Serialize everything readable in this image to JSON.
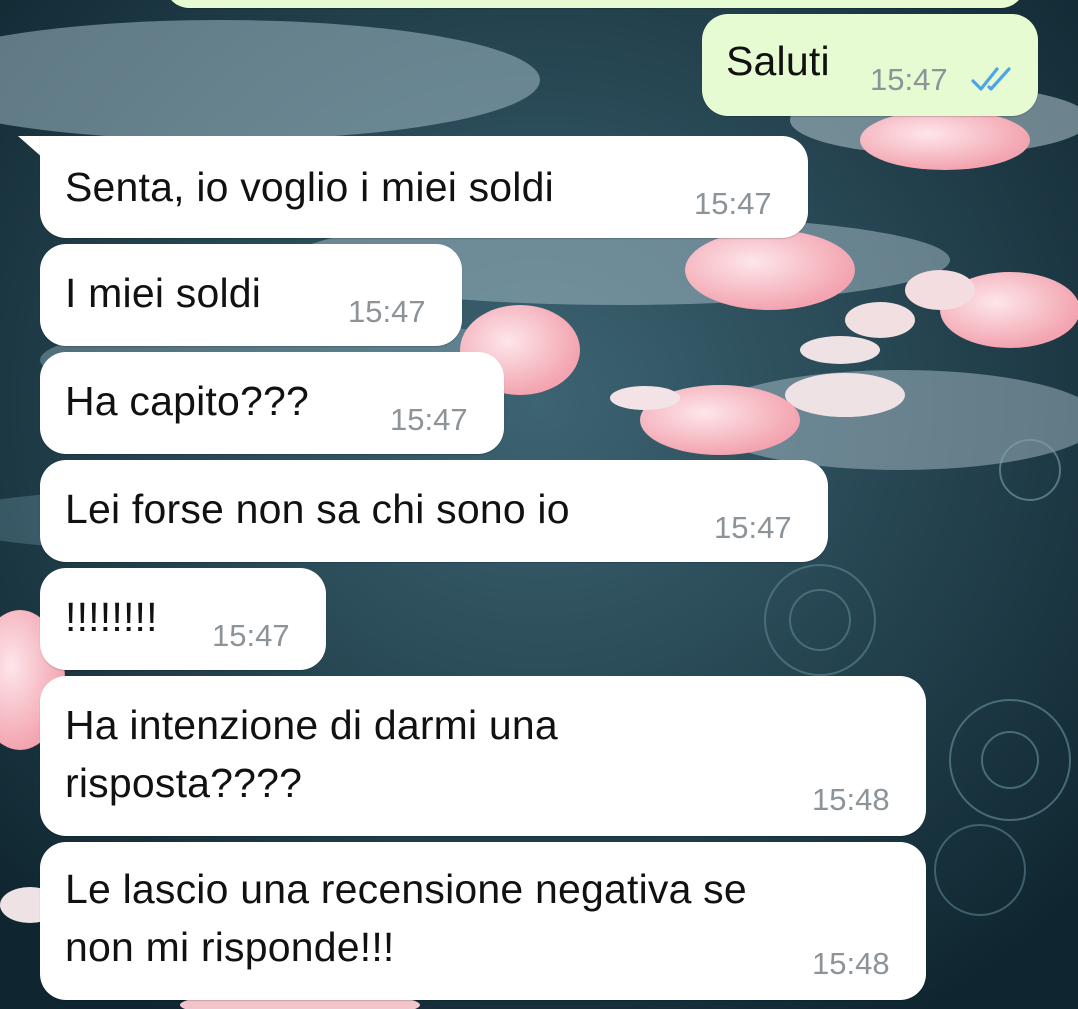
{
  "chat": {
    "outgoing": [
      {
        "text": "Saluti",
        "time": "15:47",
        "status_icon": "double-check-read-icon",
        "tick_color": "#4fa3e8"
      }
    ],
    "incoming": [
      {
        "text": "Senta, io voglio i miei soldi",
        "time": "15:47"
      },
      {
        "text": "I miei soldi",
        "time": "15:47"
      },
      {
        "text": "Ha capito???",
        "time": "15:47"
      },
      {
        "text": "Lei forse non sa chi sono io",
        "time": "15:47"
      },
      {
        "text": "!!!!!!!!",
        "time": "15:47"
      },
      {
        "line1": "Ha intenzione di darmi una",
        "line2": "risposta????",
        "time": "15:48"
      },
      {
        "line1": "Le lascio una recensione negativa se",
        "line2": "non mi risponde!!!",
        "time": "15:48"
      }
    ]
  },
  "colors": {
    "incoming_bubble": "#ffffff",
    "outgoing_bubble": "#e6fbd2",
    "timestamp": "#8c9499",
    "wallpaper": "#1d3a44"
  }
}
